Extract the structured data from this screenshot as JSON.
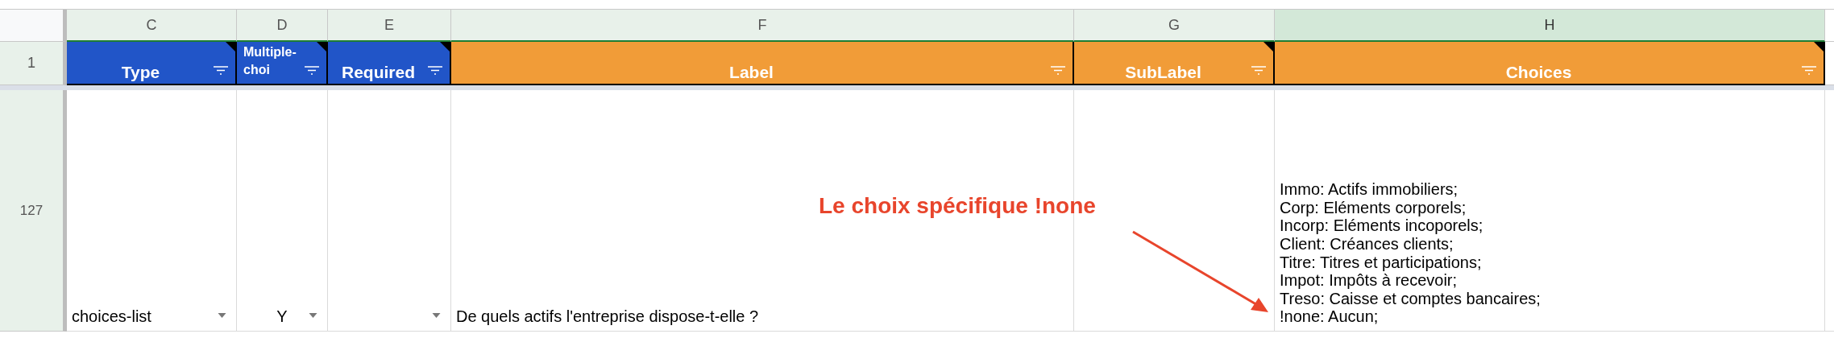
{
  "columns": [
    {
      "letter": "C",
      "selected": false
    },
    {
      "letter": "D",
      "selected": false
    },
    {
      "letter": "E",
      "selected": false
    },
    {
      "letter": "F",
      "selected": false
    },
    {
      "letter": "G",
      "selected": false
    },
    {
      "letter": "H",
      "selected": true
    }
  ],
  "header_row": {
    "number": "1",
    "cells": [
      {
        "label": "Type",
        "color": "#2155c8",
        "has_note": true
      },
      {
        "label": "Multiple-choi",
        "color": "#2155c8",
        "has_note": true
      },
      {
        "label": "Required",
        "color": "#2155c8",
        "has_note": true
      },
      {
        "label": "Label",
        "color": "#f19c38",
        "has_note": false
      },
      {
        "label": "SubLabel",
        "color": "#f19c38",
        "has_note": true
      },
      {
        "label": "Choices",
        "color": "#f19c38",
        "has_note": true
      }
    ]
  },
  "data_row": {
    "number": "127",
    "cells": [
      {
        "kind": "dropdown",
        "value": "choices-list"
      },
      {
        "kind": "dropdown",
        "value": "Y"
      },
      {
        "kind": "dropdown"
      },
      {
        "kind": "text",
        "value": "De quels actifs l'entreprise dispose-t-elle ?"
      },
      {
        "kind": "text"
      },
      {
        "kind": "lines",
        "lines": [
          "Immo: Actifs immobiliers;",
          "Corp: Eléments corporels;",
          "Incorp: Eléments incoporels;",
          "Client: Créances clients;",
          "Titre: Titres et participations;",
          "Impot: Impôts à recevoir;",
          "Treso: Caisse et comptes bancaires;",
          "!none: Aucun;"
        ]
      }
    ]
  },
  "annotation": {
    "text": "Le choix spécifique !none"
  }
}
